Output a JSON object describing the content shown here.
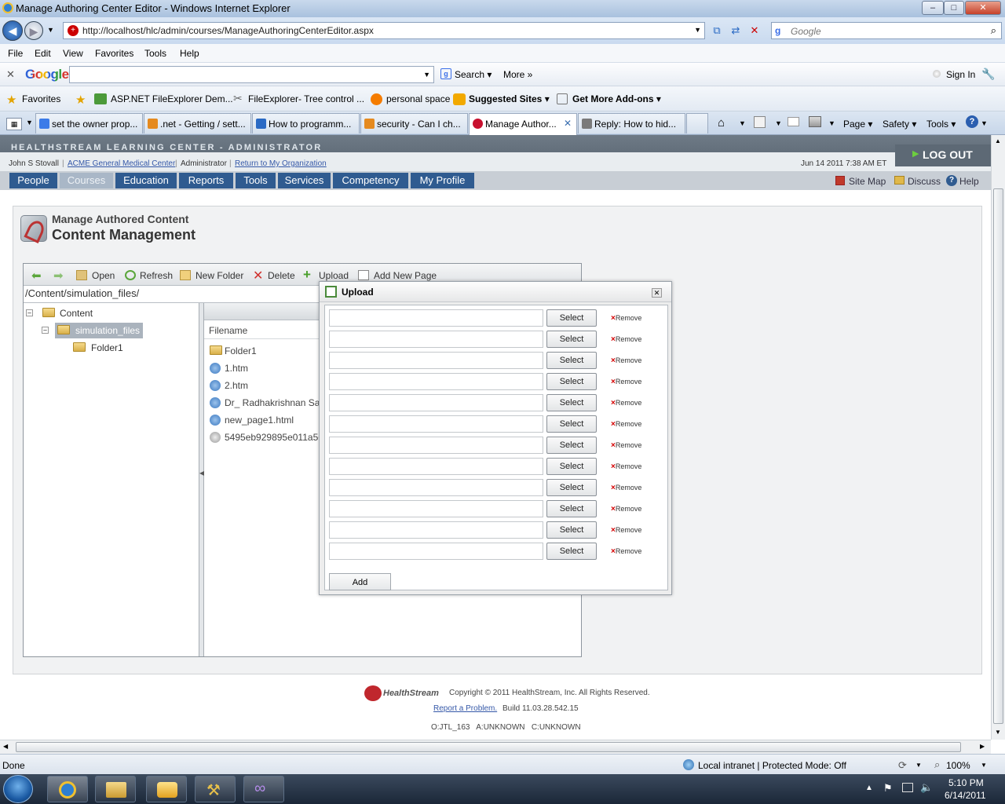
{
  "window": {
    "title": "Manage Authoring Center Editor - Windows Internet Explorer",
    "min": "–",
    "max": "□",
    "close": "✕"
  },
  "address": {
    "url": "http://localhost/hlc/admin/courses/ManageAuthoringCenterEditor.aspx",
    "search_placeholder": "Google"
  },
  "menu": [
    "File",
    "Edit",
    "View",
    "Favorites",
    "Tools",
    "Help"
  ],
  "google_toolbar": {
    "logo": "Google",
    "search_label": "Search ▾",
    "more_label": "More »",
    "sign_in": "Sign In"
  },
  "favorites_bar": {
    "favorites": "Favorites",
    "items": [
      "ASP.NET FileExplorer Dem...",
      "FileExplorer- Tree control ...",
      "personal space",
      "Suggested Sites ▾",
      "Get More Add-ons ▾"
    ]
  },
  "tabs": [
    {
      "label": "set the owner prop...",
      "color": "#3b7be8"
    },
    {
      "label": ".net - Getting / sett...",
      "color": "#e58a1f"
    },
    {
      "label": "How to programm...",
      "color": "#2a6ac4"
    },
    {
      "label": "security - Can I ch...",
      "color": "#e58a1f"
    },
    {
      "label": "Manage Author...",
      "color": "#c8102e"
    },
    {
      "label": "Reply: How to hid...",
      "color": "#7a7a7a"
    }
  ],
  "command_bar": [
    "Page ▾",
    "Safety ▾",
    "Tools ▾"
  ],
  "app": {
    "brand": "HEALTHSTREAM LEARNING CENTER - ADMINISTRATOR",
    "user": "John S Stovall",
    "org": "ACME General Medical Center",
    "role": "Administrator",
    "return_link": "Return to My Organization",
    "datetime": "Jun 14 2011 7:38 AM ET",
    "logout": "LOG OUT",
    "nav": [
      "People",
      "Courses",
      "Education",
      "Reports",
      "Tools",
      "Services",
      "Competency",
      "My Profile"
    ],
    "right_links": [
      "Site Map",
      "Discuss",
      "Help"
    ],
    "page_subtitle": "Manage Authored Content",
    "page_title": "Content Management"
  },
  "explorer": {
    "toolbar": [
      "Open",
      "Refresh",
      "New Folder",
      "Delete",
      "Upload",
      "Add New Page"
    ],
    "path": "/Content/simulation_files/",
    "tree": [
      "Content",
      "simulation_files",
      "Folder1"
    ],
    "column_header": "Filename",
    "files": [
      "Folder1",
      "1.htm",
      "2.htm",
      "Dr_ Radhakrishnan Sala",
      "new_page1.html",
      "5495eb929895e011a56b"
    ]
  },
  "upload_dialog": {
    "title": "Upload",
    "select_label": "Select",
    "remove_label": "Remove",
    "add_label": "Add",
    "rows": 12
  },
  "footer": {
    "copyright": "Copyright © 2011 HealthStream, Inc. All Rights Reserved.",
    "logo_text": "HealthStream",
    "report": "Report a Problem.",
    "build": "Build 11.03.28.542.15",
    "ids": "O:JTL_163   A:UNKNOWN   C:UNKNOWN"
  },
  "status": {
    "left": "Done",
    "zone": "Local intranet | Protected Mode: Off",
    "zoom": "100%"
  },
  "clock": {
    "time": "5:10 PM",
    "date": "6/14/2011"
  }
}
